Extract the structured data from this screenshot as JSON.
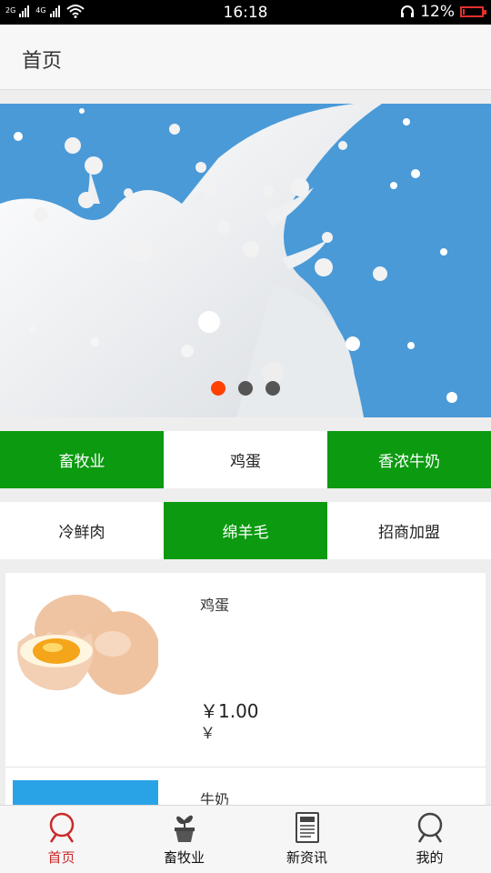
{
  "status_bar": {
    "time": "16:18",
    "battery_text": "12%",
    "signal_left": "2G",
    "signal_right": "4G",
    "battery_level": 0.12
  },
  "header": {
    "title": "首页"
  },
  "banner": {
    "slide_count": 3,
    "active_index": 0
  },
  "categories": [
    {
      "label": "畜牧业",
      "highlight": true
    },
    {
      "label": "鸡蛋",
      "highlight": false
    },
    {
      "label": "香浓牛奶",
      "highlight": true
    },
    {
      "label": "冷鲜肉",
      "highlight": false
    },
    {
      "label": "绵羊毛",
      "highlight": true
    },
    {
      "label": "招商加盟",
      "highlight": false
    }
  ],
  "products": [
    {
      "name": "鸡蛋",
      "price": "￥1.00",
      "currency": "￥"
    },
    {
      "name": "牛奶"
    }
  ],
  "nav": [
    {
      "label": "首页",
      "icon": "home-icon",
      "active": true
    },
    {
      "label": "畜牧业",
      "icon": "plant-icon",
      "active": false
    },
    {
      "label": "新资讯",
      "icon": "news-icon",
      "active": false
    },
    {
      "label": "我的",
      "icon": "user-icon",
      "active": false
    }
  ],
  "colors": {
    "accent_green": "#0b9a10",
    "banner_blue": "#4a9ad8",
    "active_red": "#cc2a2a",
    "dot_active": "#ff4000"
  }
}
